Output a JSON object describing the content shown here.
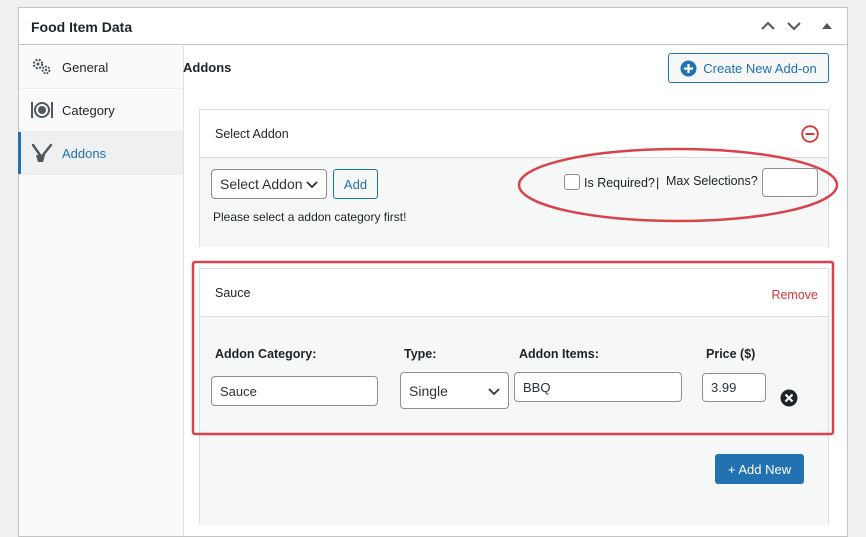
{
  "metabox": {
    "title": "Food Item Data",
    "controls": [
      "chevron-up-icon",
      "chevron-down-icon",
      "triangle-up-icon"
    ]
  },
  "sidebar": {
    "items": [
      {
        "label": "General",
        "icon": "gears-icon"
      },
      {
        "label": "Category",
        "icon": "dinner-plate-icon"
      },
      {
        "label": "Addons",
        "icon": "addon-tools-icon",
        "active": true
      }
    ]
  },
  "main": {
    "title": "Addons",
    "create_button": "Create New Add-on"
  },
  "select_panel": {
    "title": "Select Addon",
    "select_value": "Select Addon",
    "add_button": "Add",
    "required_label": "Is Required?",
    "separator": "|",
    "max_label": "Max Selections?",
    "max_value": "",
    "hint": "Please select a addon category first!"
  },
  "addon_panel": {
    "title": "Sauce",
    "remove_label": "Remove",
    "category_label": "Addon Category:",
    "category_value": "Sauce",
    "type_label": "Type:",
    "type_value": "Single",
    "items_label": "Addon Items:",
    "items_value": "BBQ",
    "price_label": "Price ($)",
    "price_value": "3.99",
    "add_new_button": "+ Add New"
  },
  "colors": {
    "accent": "#2271b1",
    "danger": "#d63638",
    "annotation": "#d9434a"
  }
}
